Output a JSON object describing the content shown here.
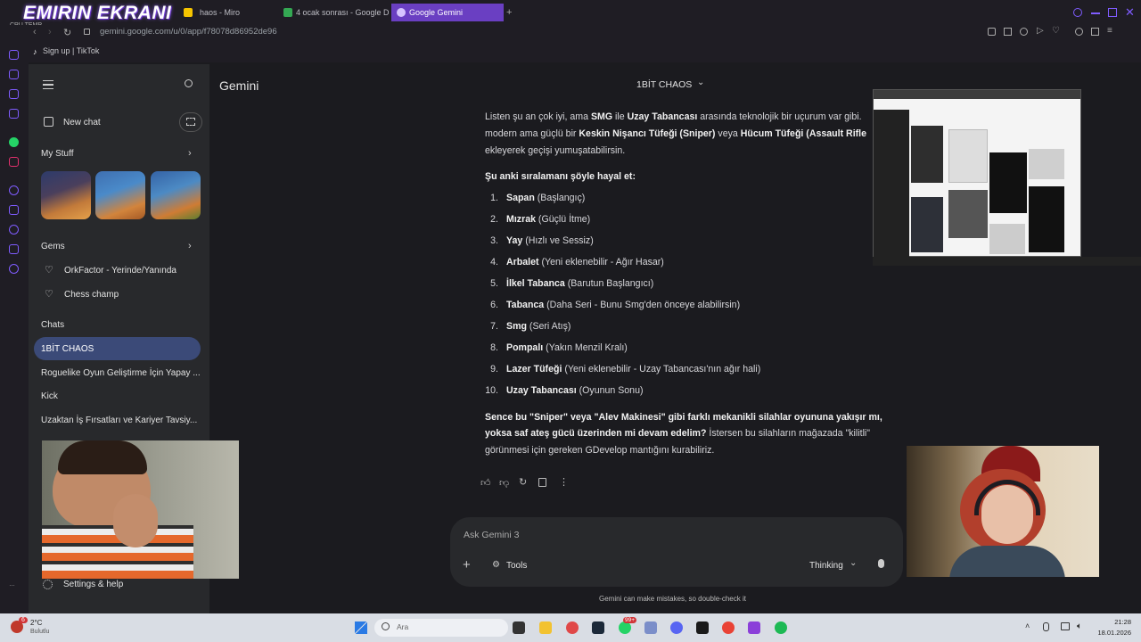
{
  "overlay": {
    "streamer_title": "EMIRIN EKRANI",
    "cpu_temp": "CPU TEMP"
  },
  "browser": {
    "tabs": [
      {
        "label": "haos - Miro",
        "color": "#f5c400"
      },
      {
        "label": "4 ocak sonrası - Google D",
        "color": "#34a853"
      },
      {
        "label": "Google Gemini",
        "color": "#a37cff"
      }
    ],
    "url": "gemini.google.com/u/0/app/f78078d86952de96",
    "bookmark": "Sign up | TikTok"
  },
  "sidebar": {
    "new_chat": "New chat",
    "my_stuff": "My Stuff",
    "gems_header": "Gems",
    "gems": [
      "OrkFactor - Yerinde/Yanında",
      "Chess champ"
    ],
    "chats_header": "Chats",
    "chats": [
      "1BİT CHAOS",
      "Roguelike Oyun Geliştirme İçin Yapay ...",
      "Kick",
      "Uzaktan İş Fırsatları ve Kariyer Tavsiy..."
    ],
    "settings": "Settings & help"
  },
  "header": {
    "app_title": "Gemini",
    "chat_title": "1BİT CHAOS"
  },
  "response": {
    "p1": [
      {
        "t": "Listen şu an çok iyi, ama ",
        "b": false
      },
      {
        "t": "SMG",
        "b": true
      },
      {
        "t": " ile ",
        "b": false
      },
      {
        "t": "Uzay Tabancası",
        "b": true
      },
      {
        "t": " arasında teknolojik bir uçurum var gibi.",
        "b": false
      }
    ],
    "p2": [
      {
        "t": "modern ama güçlü bir ",
        "b": false
      },
      {
        "t": "Keskin Nişancı Tüfeği (Sniper)",
        "b": true
      },
      {
        "t": " veya ",
        "b": false
      },
      {
        "t": "Hücum Tüfeği (Assault Rifle",
        "b": true
      }
    ],
    "p3": "ekleyerek geçişi yumuşatabilirsin.",
    "list_header": "Şu anki sıralamanı şöyle hayal et:",
    "items": [
      {
        "n": "1.",
        "name": "Sapan",
        "desc": " (Başlangıç)"
      },
      {
        "n": "2.",
        "name": "Mızrak",
        "desc": " (Güçlü İtme)"
      },
      {
        "n": "3.",
        "name": "Yay",
        "desc": " (Hızlı ve Sessiz)"
      },
      {
        "n": "4.",
        "name": "Arbalet",
        "desc": " (Yeni eklenebilir - Ağır Hasar)"
      },
      {
        "n": "5.",
        "name": "İlkel Tabanca",
        "desc": " (Barutun Başlangıcı)"
      },
      {
        "n": "6.",
        "name": "Tabanca",
        "desc": " (Daha Seri - Bunu Smg'den önceye alabilirsin)"
      },
      {
        "n": "7.",
        "name": "Smg",
        "desc": " (Seri Atış)"
      },
      {
        "n": "8.",
        "name": "Pompalı",
        "desc": " (Yakın Menzil Kralı)"
      },
      {
        "n": "9.",
        "name": "Lazer Tüfeği",
        "desc": " (Yeni eklenebilir - Uzay Tabancası'nın ağır hali)"
      },
      {
        "n": "10.",
        "name": "Uzay Tabancası",
        "desc": " (Oyunun Sonu)"
      }
    ],
    "q1": "Sence bu \"Sniper\" veya \"Alev Makinesi\" gibi farklı mekanikli silahlar oyununa yakışır mı,",
    "q2_bold": "yoksa saf ateş gücü üzerinden mi devam edelim?",
    "q2_rest": " İstersen bu silahların mağazada \"kilitli\"",
    "q3": "görünmesi için gereken GDevelop mantığını kurabiliriz."
  },
  "input": {
    "placeholder": "Ask Gemini 3",
    "tools": "Tools",
    "mode": "Thinking",
    "disclaimer": "Gemini can make mistakes, so double-check it"
  },
  "taskbar": {
    "temp": "2°C",
    "weather": "Bulutlu",
    "badge": "6",
    "search": "Ara",
    "badge2": "99+",
    "time": "21:28",
    "date": "18.01.2026"
  }
}
